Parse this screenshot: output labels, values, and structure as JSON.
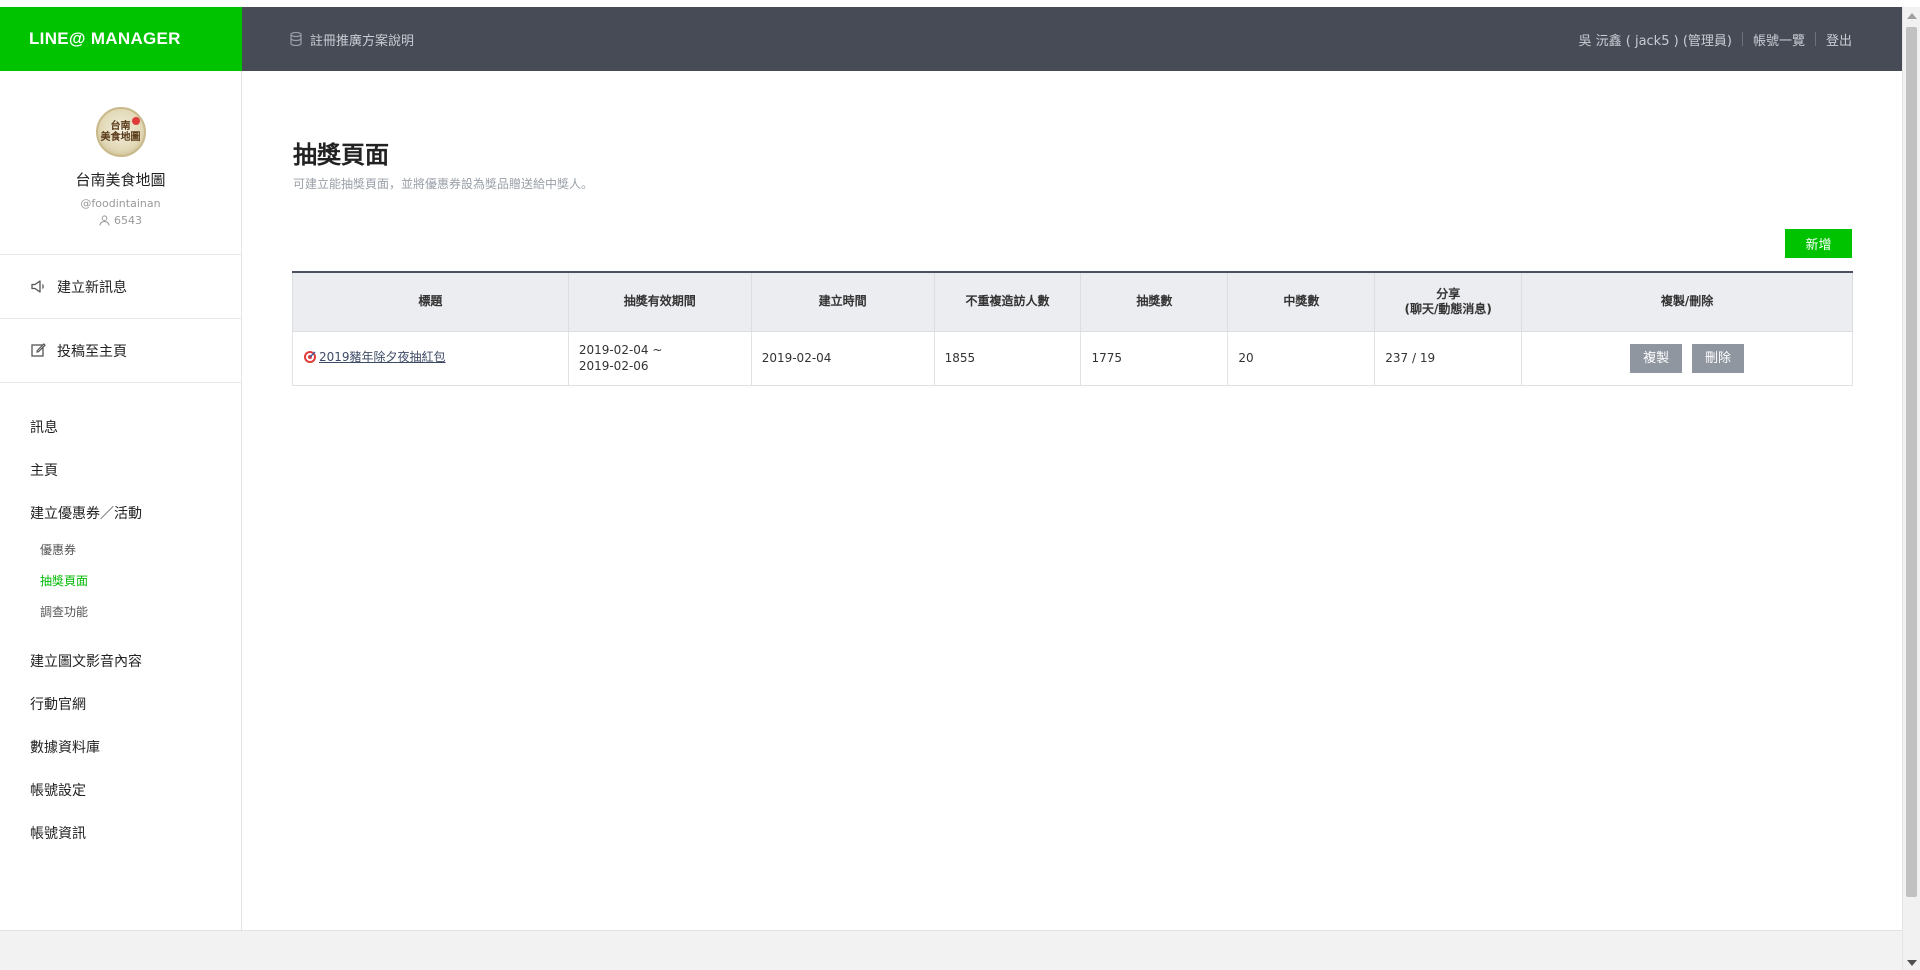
{
  "header": {
    "logo": "LINE@ MANAGER",
    "promo_link": "註冊推廣方案說明",
    "user": "吳 沅鑫 ( jack5 ) (管理員)",
    "accounts_link": "帳號一覽",
    "logout_link": "登出"
  },
  "profile": {
    "avatar_text_top": "台南",
    "avatar_text_bottom": "美食地圖",
    "name": "台南美食地圖",
    "id": "@foodintainan",
    "friends": "6543"
  },
  "sidebar": {
    "actions": [
      {
        "label": "建立新訊息",
        "icon": "megaphone-icon"
      },
      {
        "label": "投稿至主頁",
        "icon": "edit-icon"
      }
    ],
    "nav": {
      "messages": "訊息",
      "home": "主頁",
      "coupons_events": "建立優惠券／活動",
      "sub_coupon": "優惠券",
      "sub_lottery": "抽獎頁面",
      "sub_survey": "調查功能",
      "rich_content": "建立圖文影音內容",
      "mobile_site": "行動官網",
      "data_library": "數據資料庫",
      "account_settings": "帳號設定",
      "account_info": "帳號資訊"
    }
  },
  "main": {
    "title": "抽獎頁面",
    "description": "可建立能抽獎頁面，並將優惠券設為獎品贈送給中獎人。",
    "add_button": "新增",
    "table": {
      "headers": {
        "title": "標題",
        "period": "抽獎有效期間",
        "created": "建立時間",
        "visitors": "不重複造訪人數",
        "draws": "抽獎數",
        "winners": "中獎數",
        "share_line1": "分享",
        "share_line2": "(聊天/動態消息)",
        "copy_delete": "複製/刪除"
      },
      "rows": [
        {
          "title": "2019豬年除夕夜抽紅包",
          "period_start": "2019-02-04 ~",
          "period_end": "2019-02-06",
          "created": "2019-02-04",
          "visitors": "1855",
          "draws": "1775",
          "winners": "20",
          "share": "237 / 19",
          "copy": "複製",
          "delete": "刪除"
        }
      ]
    }
  },
  "colors": {
    "brand_green": "#00c300",
    "header_dark": "#474b55",
    "active_green": "#00b900",
    "action_gray": "#8f96a0"
  }
}
